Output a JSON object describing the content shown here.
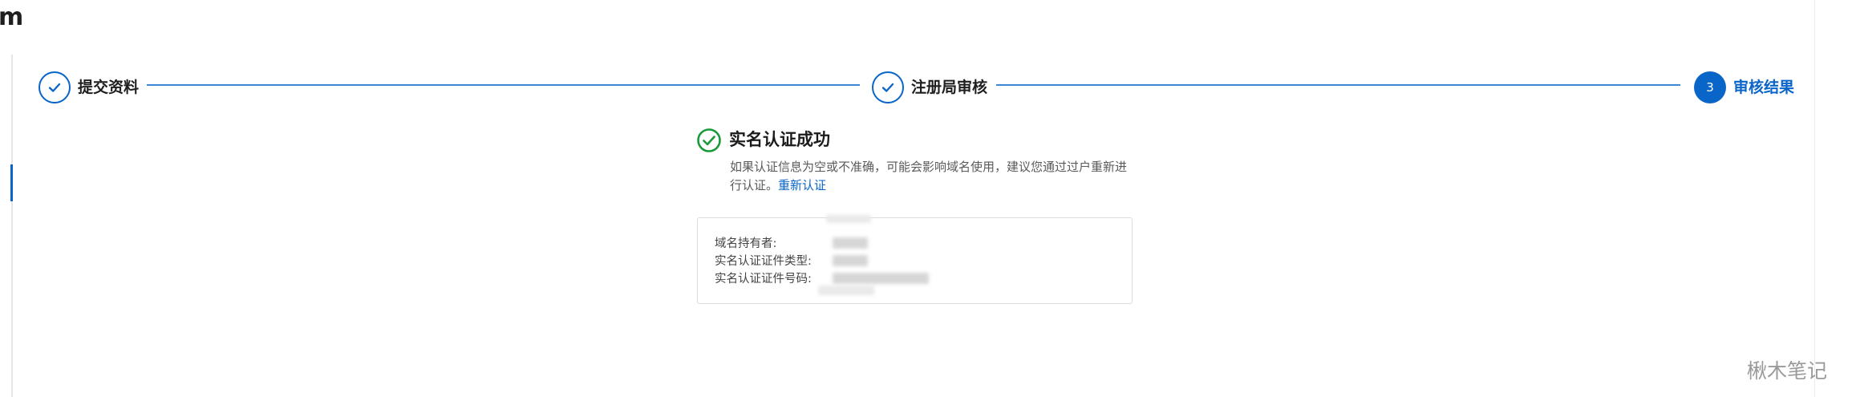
{
  "corner": {
    "text": "m"
  },
  "steps": [
    {
      "label": "提交资料",
      "state": "done",
      "icon": "check-icon"
    },
    {
      "label": "注册局审核",
      "state": "done",
      "icon": "check-icon"
    },
    {
      "label": "审核结果",
      "state": "active",
      "number": "3"
    }
  ],
  "result": {
    "icon": "success-check-circle-icon",
    "title": "实名认证成功",
    "description": "如果认证信息为空或不准确，可能会影响域名使用，建议您通过过户重新进行认证。",
    "link_label": "重新认证"
  },
  "info": {
    "rows": [
      {
        "label": "域名持有者:"
      },
      {
        "label": "实名认证证件类型:"
      },
      {
        "label": "实名认证证件号码:"
      }
    ]
  },
  "watermark": "楸木笔记",
  "colors": {
    "accent": "#0a65c8",
    "success": "#1a9a3a",
    "line": "#3d86d8"
  }
}
